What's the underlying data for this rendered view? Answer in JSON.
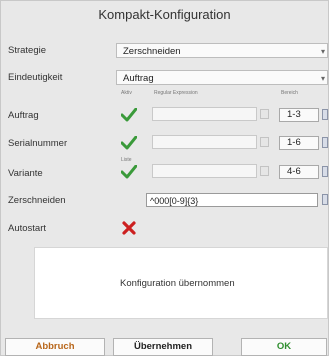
{
  "dialog": {
    "title": "Kompakt-Konfiguration"
  },
  "labels": {
    "strategie": "Strategie",
    "eindeutigkeit": "Eindeutigkeit",
    "auftrag": "Auftrag",
    "serialnummer": "Serialnummer",
    "variante": "Variante",
    "zerschneiden": "Zerschneiden",
    "autostart": "Autostart"
  },
  "strategie": {
    "value": "Zerschneiden"
  },
  "eindeutigkeit": {
    "value": "Auftrag"
  },
  "column_headers": {
    "aktiv": "Aktiv",
    "regex": "Regular Expression",
    "bereich": "Bereich",
    "liste": "Liste"
  },
  "rows": {
    "auftrag": {
      "range": "1-3",
      "active": true
    },
    "serialnummer": {
      "range": "1-6",
      "active": true
    },
    "variante": {
      "range": "4-6",
      "active": true
    }
  },
  "zerschneiden": {
    "value": "^000[0-9]{3}"
  },
  "autostart": {
    "enabled": false
  },
  "status": {
    "message": "Konfiguration übernommen"
  },
  "buttons": {
    "abbruch": "Abbruch",
    "uebernehmen": "Übernehmen",
    "ok": "OK"
  },
  "colors": {
    "abbruch_text": "#b8661a",
    "ok_text": "#2f8f2f",
    "check_green": "#3a9a3a",
    "cross_red": "#cc2020"
  }
}
